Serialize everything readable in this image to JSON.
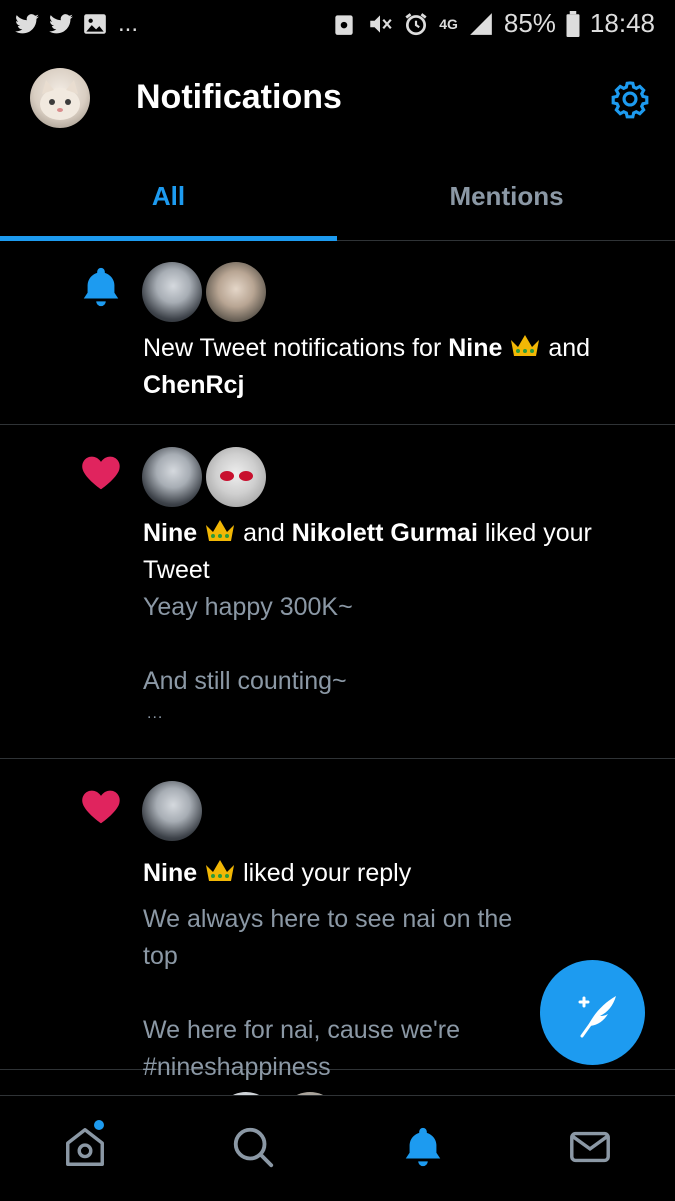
{
  "status_bar": {
    "more_indicator": "...",
    "network": "4G",
    "battery_text": "85%",
    "time": "18:48"
  },
  "header": {
    "title": "Notifications"
  },
  "tabs": [
    {
      "label": "All",
      "selected": true
    },
    {
      "label": "Mentions",
      "selected": false
    }
  ],
  "notifications": [
    {
      "type": "tweet-notifications",
      "icon": "bell-icon",
      "prefix": "New Tweet notifications for ",
      "user1": "Nine",
      "joiner": " and ",
      "user2": "ChenRcj"
    },
    {
      "type": "like",
      "icon": "heart-icon",
      "user1": "Nine",
      "joiner": " and ",
      "user2": "Nikolett Gurmai",
      "action": " liked your Tweet",
      "content": "Yeay happy 300K~\n\nAnd still counting~",
      "ellipsis": "..."
    },
    {
      "type": "like",
      "icon": "heart-icon",
      "user1": "Nine",
      "action": " liked your reply",
      "content": "We always here to see nai on the top\n\nWe here for nai, cause we're\n#nineshappiness"
    }
  ],
  "colors": {
    "accent": "#1d9bf0",
    "like": "#e0245e",
    "secondary_text": "#8b98a5",
    "divider": "#2f3336",
    "background": "#000000"
  }
}
